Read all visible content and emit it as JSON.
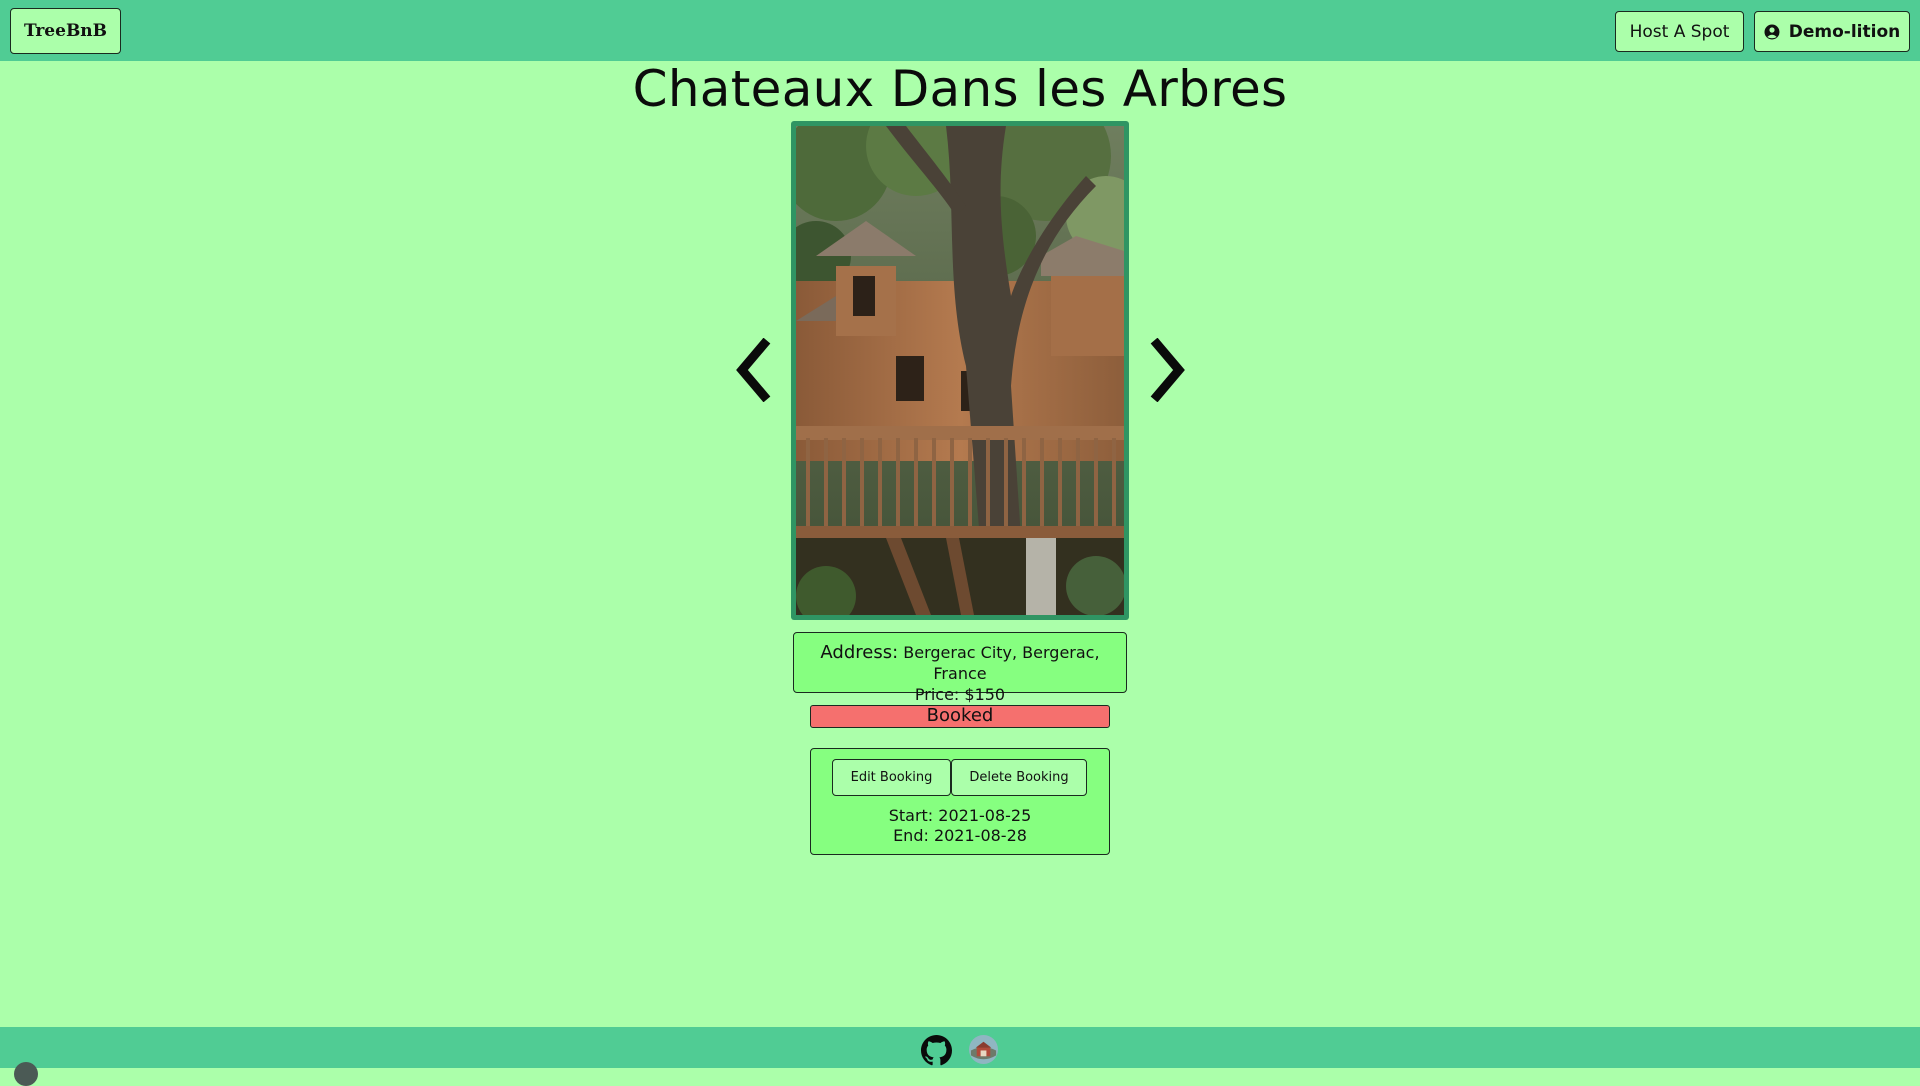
{
  "header": {
    "logo": "TreeBnB",
    "host_button": "Host A Spot",
    "user_button": "Demo-lition",
    "user_icon": "user-circle-icon"
  },
  "listing": {
    "title": "Chateaux Dans les Arbres",
    "address_label": "Address:",
    "address_value": "Bergerac City, Bergerac, France",
    "price": "Price: $150",
    "status": "Booked"
  },
  "carousel": {
    "prev_icon": "chevron-left-icon",
    "next_icon": "chevron-right-icon"
  },
  "booking": {
    "edit_label": "Edit Booking",
    "delete_label": "Delete Booking",
    "start": "Start: 2021-08-25",
    "end": "End: 2021-08-28"
  },
  "footer": {
    "icons": [
      "github-icon",
      "portfolio-icon"
    ]
  },
  "colors": {
    "page_bg": "#abffaa",
    "bar_bg": "#50cc94",
    "panel_bg": "#86ff80",
    "status_booked": "#f5706e",
    "photo_border": "#2f9563"
  }
}
